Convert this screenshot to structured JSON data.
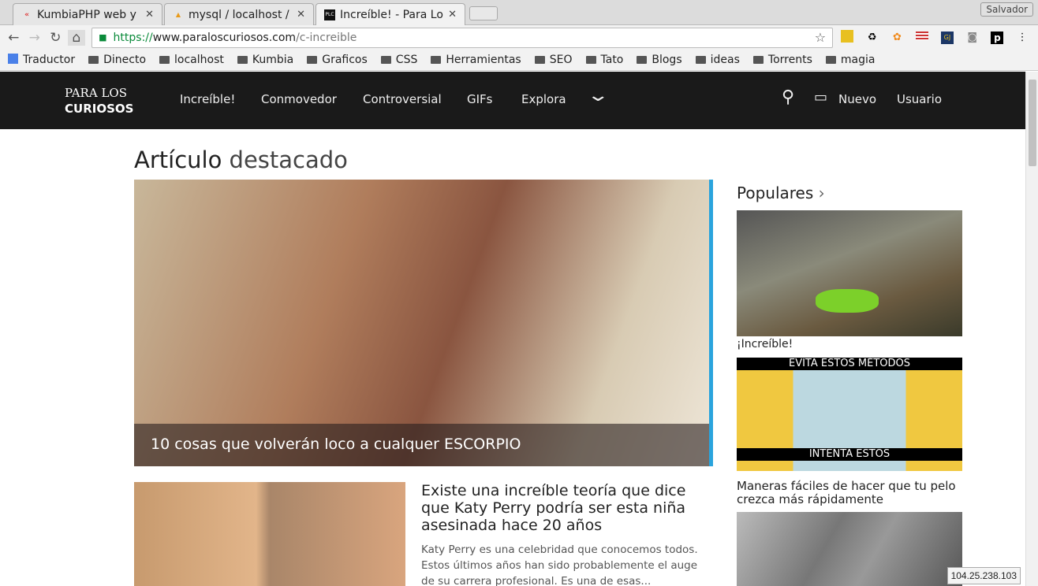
{
  "browser": {
    "tabs": [
      {
        "title": "KumbiaPHP web y a",
        "favicon": "K"
      },
      {
        "title": "mysql / localhost / e",
        "favicon": "PMA"
      },
      {
        "title": "Increíble! - Para Los",
        "favicon": "PLC"
      }
    ],
    "profile": "Salvador",
    "url": {
      "scheme": "https://",
      "domain": "www.paraloscuriosos.com",
      "path": "/c-increible"
    },
    "bookmarks": [
      "Traductor",
      "Dinecto",
      "localhost",
      "Kumbia",
      "Graficos",
      "CSS",
      "Herramientas",
      "SEO",
      "Tato",
      "Blogs",
      "ideas",
      "Torrents",
      "magia"
    ]
  },
  "site": {
    "logo_top": "PARA LOS",
    "logo_bottom": "CURIOSOS",
    "nav": [
      "Increíble!",
      "Conmovedor",
      "Controversial",
      "GIFs",
      "Explora"
    ],
    "new_label": "Nuevo",
    "user_label": "Usuario",
    "heading_bold": "Artículo",
    "heading_rest": " destacado",
    "hero_caption": "10 cosas que volverán loco a cualquer ESCORPIO",
    "article": {
      "title": "Existe una increíble teoría que dice que Katy Perry podría ser esta niña asesinada hace 20 años",
      "summary": "Katy Perry es una celebridad que conocemos todos. Estos últimos años han sido probablemente el auge de su carrera profesional. Es una de esas..."
    },
    "popular_heading": "Populares",
    "popular": [
      {
        "caption": "¡Increíble!"
      },
      {
        "caption": "Maneras fáciles de hacer que tu pelo crezca más rápidamente",
        "band_top": "EVITA ESTOS MÉTODOS",
        "band_bottom": "INTENTA ESTOS"
      }
    ]
  },
  "status_ip": "104.25.238.103"
}
